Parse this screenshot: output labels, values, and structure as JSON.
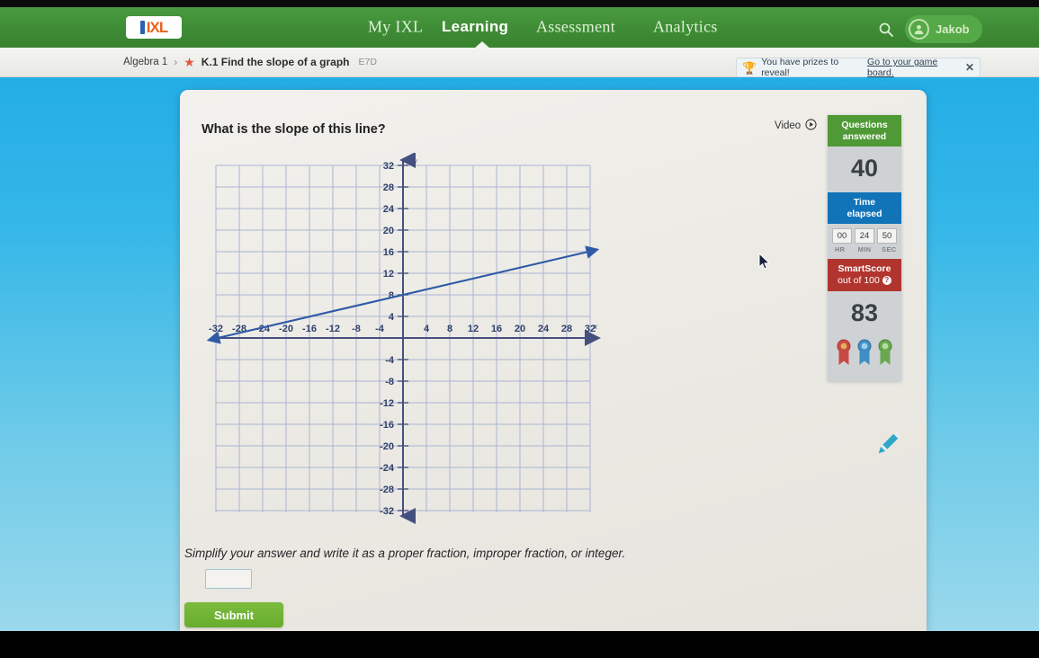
{
  "nav": {
    "logo_text": "IXL",
    "items": [
      {
        "label": "My IXL",
        "active": false
      },
      {
        "label": "Learning",
        "active": true
      },
      {
        "label": "Assessment",
        "active": false
      },
      {
        "label": "Analytics",
        "active": false
      }
    ],
    "search_icon": "search-icon",
    "username": "Jakob"
  },
  "breadcrumb": {
    "subject": "Algebra 1",
    "separator": "›",
    "star": "★",
    "skill": "K.1 Find the slope of a graph",
    "code": "E7D"
  },
  "prize_banner": {
    "trophy_icon": "trophy-icon",
    "message": "You have prizes to reveal!",
    "link": "Go to your game board.",
    "close": "✕"
  },
  "question": {
    "prompt": "What is the slope of this line?",
    "video_label": "Video",
    "play_icon": "play-circle-icon",
    "instruction": "Simplify your answer and write it as a proper fraction, improper fraction, or integer.",
    "answer_value": "",
    "answer_placeholder": "",
    "submit_label": "Submit"
  },
  "stats": {
    "questions_answered_label_line1": "Questions",
    "questions_answered_label_line2": "answered",
    "questions_answered_value": "40",
    "time_elapsed_label_line1": "Time",
    "time_elapsed_label_line2": "elapsed",
    "time_hr": "00",
    "time_min": "24",
    "time_sec": "50",
    "unit_hr": "HR",
    "unit_min": "MIN",
    "unit_sec": "SEC",
    "smartscore_label": "SmartScore",
    "smartscore_sub": "out of 100",
    "smartscore_help": "?",
    "smartscore_value": "83",
    "ribbon_colors": [
      "#c94a42",
      "#3f8fc4",
      "#6aa84f"
    ]
  },
  "pencil_icon": "pencil-icon",
  "cursor_icon": "mouse-cursor",
  "colors": {
    "nav_green": "#3e8c35",
    "accent_green": "#68ad2e",
    "panel_blue": "#1173b8",
    "panel_red": "#b1352e",
    "grid_line": "#a8b4d4",
    "axis": "#2e3f6b",
    "line_color": "#2e5aa8",
    "page_bg_top": "#1ba9e4"
  },
  "chart_data": {
    "type": "line",
    "title": "",
    "xlabel": "x",
    "ylabel": "y",
    "xlim": [
      -34,
      34
    ],
    "ylim": [
      -34,
      34
    ],
    "xticks": [
      -32,
      -28,
      -24,
      -20,
      -16,
      -12,
      -8,
      -4,
      4,
      8,
      12,
      16,
      20,
      24,
      28,
      32
    ],
    "yticks": [
      32,
      28,
      24,
      20,
      16,
      12,
      8,
      4,
      -4,
      -8,
      -12,
      -16,
      -20,
      -24,
      -28,
      -32
    ],
    "tick_step": 4,
    "grid": true,
    "legend": null,
    "series": [
      {
        "name": "line",
        "points": [
          [
            -32,
            0
          ],
          [
            32,
            16
          ]
        ],
        "y_intercept": 8,
        "slope": 0.25,
        "arrow_start": true,
        "arrow_end": true
      }
    ]
  }
}
